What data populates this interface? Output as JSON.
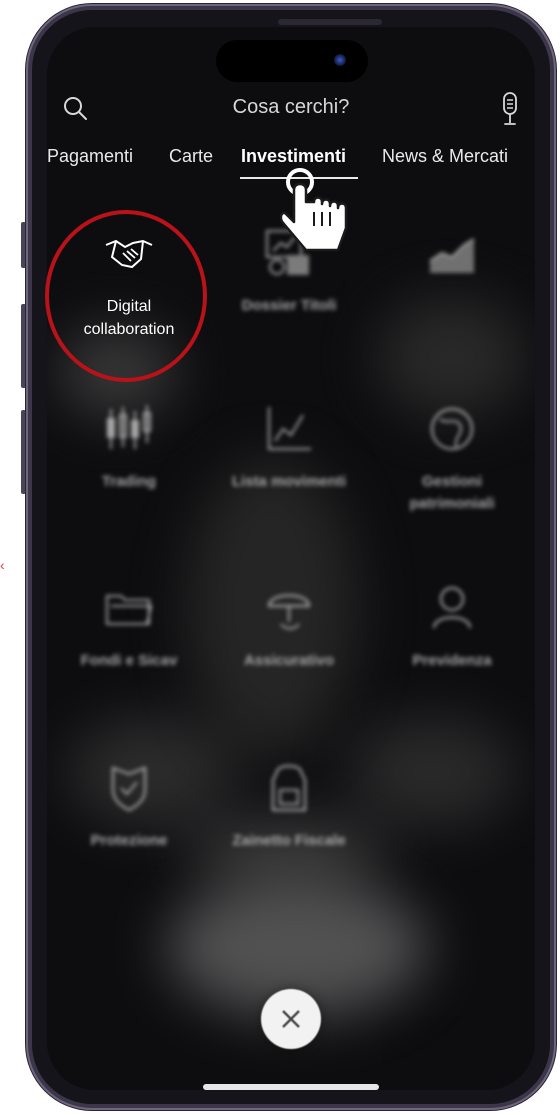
{
  "search": {
    "placeholder": "Cosa cerchi?"
  },
  "tabs": [
    {
      "label": "Pagamenti"
    },
    {
      "label": "Carte"
    },
    {
      "label": "Investimenti",
      "active": true
    },
    {
      "label": "News & Mercati"
    }
  ],
  "tiles": [
    {
      "label": "Digital collaboration",
      "icon": "handshake-icon"
    },
    {
      "label": "Dossier Titoli",
      "icon": "portfolio-chart-icon"
    },
    {
      "label": "",
      "icon": "area-chart-icon"
    },
    {
      "label": "Trading",
      "icon": "candlestick-icon"
    },
    {
      "label": "Lista movimenti",
      "icon": "line-chart-icon"
    },
    {
      "label": "Gestioni patrimoniali",
      "icon": "globe-icon"
    },
    {
      "label": "Fondi e Sicav",
      "icon": "folder-icon"
    },
    {
      "label": "Assicurativo",
      "icon": "umbrella-icon"
    },
    {
      "label": "Previdenza",
      "icon": "person-icon"
    },
    {
      "label": "Protezione",
      "icon": "shield-icon"
    },
    {
      "label": "Zainetto Fiscale",
      "icon": "backpack-icon"
    }
  ],
  "colors": {
    "highlight": "#b91219",
    "background": "#0d0d0f"
  }
}
